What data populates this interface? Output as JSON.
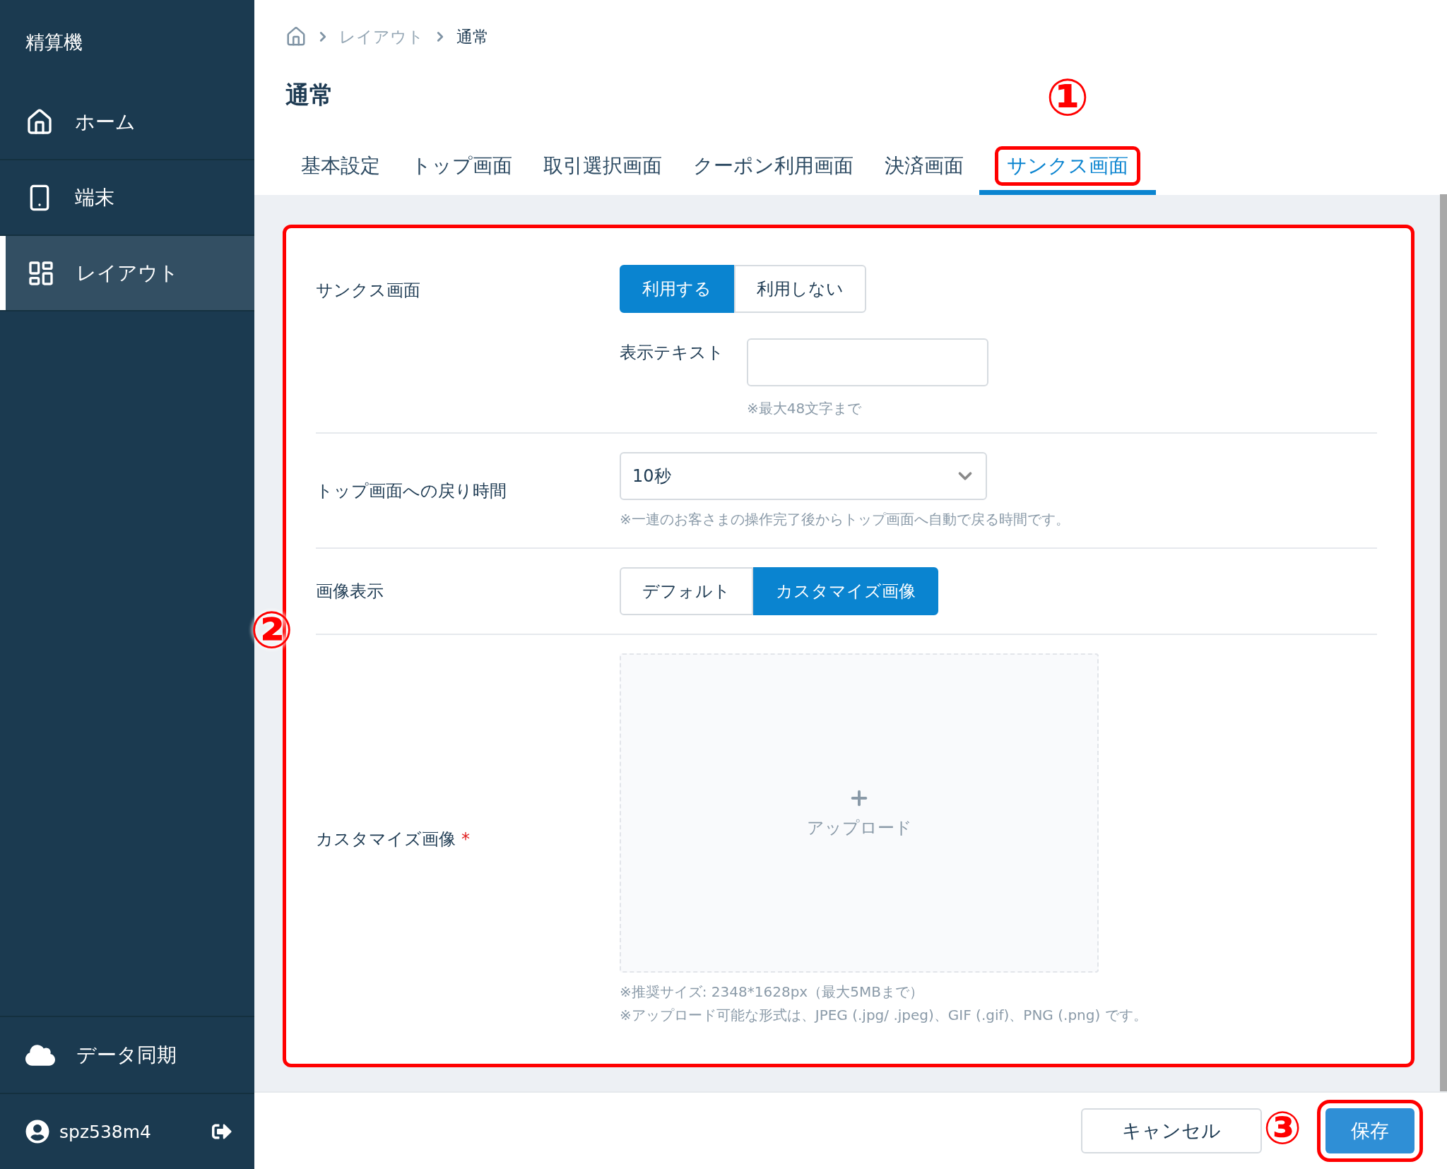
{
  "sidebar": {
    "title": "精算機",
    "items": [
      {
        "label": "ホーム",
        "selected": false
      },
      {
        "label": "端末",
        "selected": false
      },
      {
        "label": "レイアウト",
        "selected": true
      }
    ],
    "sync": {
      "label": "データ同期"
    },
    "user": {
      "name": "spz538m4"
    }
  },
  "breadcrumb": [
    "レイアウト",
    "通常"
  ],
  "page_title": "通常",
  "tabs": [
    {
      "label": "基本設定",
      "selected": false
    },
    {
      "label": "トップ画面",
      "selected": false
    },
    {
      "label": "取引選択画面",
      "selected": false
    },
    {
      "label": "クーポン利用画面",
      "selected": false
    },
    {
      "label": "決済画面",
      "selected": false
    },
    {
      "label": "サンクス画面",
      "selected": true,
      "annotation": "①"
    }
  ],
  "form": {
    "annotation": "②",
    "rows": [
      {
        "kind": "toggle",
        "label": "サンクス画面",
        "options": [
          {
            "label": "利用する",
            "selected": true
          },
          {
            "label": "利用しない",
            "selected": false
          }
        ],
        "subfield": {
          "label": "表示テキスト",
          "hint": "※最大48文字まで"
        }
      },
      {
        "kind": "select",
        "label": "トップ画面への戻り時間",
        "value": "10秒",
        "hint": "※一連のお客さまの操作完了後からトップ画面へ自動で戻る時間です。"
      },
      {
        "kind": "toggle",
        "label": "画像表示",
        "options": [
          {
            "label": "デフォルト",
            "selected": false
          },
          {
            "label": "カスタマイズ画像",
            "selected": true
          }
        ]
      },
      {
        "kind": "upload",
        "label": "カスタマイズ画像",
        "required_mark": "*",
        "upload_label": "アップロード",
        "hints": [
          "※推奨サイズ: 2348*1628px（最大5MBまで）",
          "※アップロード可能な形式は、JPEG (.jpg/ .jpeg)、GIF (.gif)、PNG (.png) です。"
        ]
      }
    ]
  },
  "footer": {
    "buttons": [
      {
        "label": "キャンセル",
        "kind": "secondary"
      },
      {
        "label": "保存",
        "kind": "primary",
        "annotation": "③"
      }
    ]
  }
}
